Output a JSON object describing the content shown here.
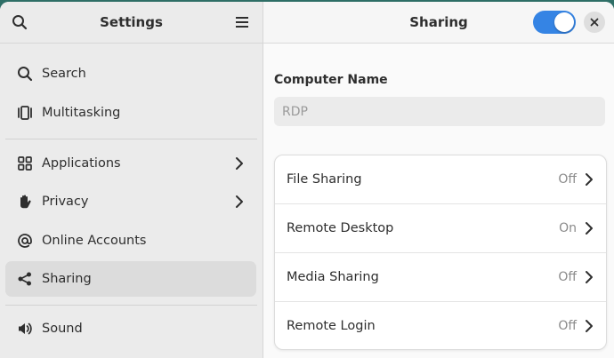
{
  "sidebar": {
    "title": "Settings",
    "items": [
      {
        "label": "Search",
        "icon": "search-icon"
      },
      {
        "label": "Multitasking",
        "icon": "multitasking-icon"
      },
      {
        "label": "Applications",
        "icon": "applications-icon",
        "has_chevron": true
      },
      {
        "label": "Privacy",
        "icon": "privacy-hand-icon",
        "has_chevron": true
      },
      {
        "label": "Online Accounts",
        "icon": "at-sign-icon"
      },
      {
        "label": "Sharing",
        "icon": "share-icon",
        "active": true
      },
      {
        "label": "Sound",
        "icon": "speaker-icon"
      }
    ]
  },
  "main": {
    "title": "Sharing",
    "toggle_on": true,
    "computer_name_label": "Computer Name",
    "computer_name_value": "RDP",
    "rows": [
      {
        "label": "File Sharing",
        "status": "Off"
      },
      {
        "label": "Remote Desktop",
        "status": "On"
      },
      {
        "label": "Media Sharing",
        "status": "Off"
      },
      {
        "label": "Remote Login",
        "status": "Off"
      }
    ]
  },
  "colors": {
    "accent": "#3584e4",
    "desktop_bg": "#2e6e66",
    "sidebar_bg": "#ebebeb",
    "active_item_bg": "#dcdcdc"
  }
}
